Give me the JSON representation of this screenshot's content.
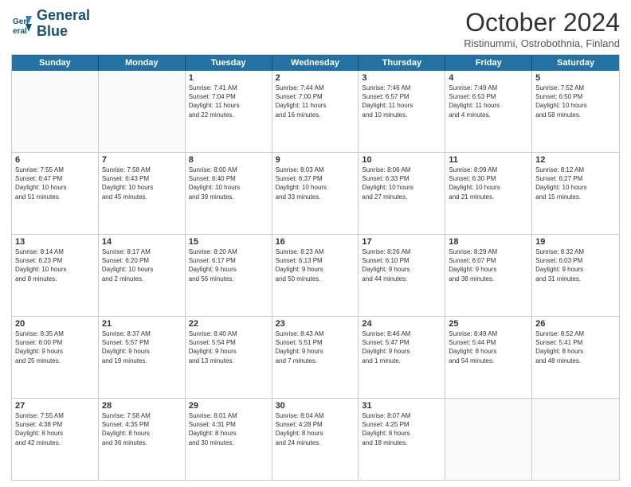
{
  "header": {
    "logo_line1": "General",
    "logo_line2": "Blue",
    "month": "October 2024",
    "location": "Ristinummi, Ostrobothnia, Finland"
  },
  "weekdays": [
    "Sunday",
    "Monday",
    "Tuesday",
    "Wednesday",
    "Thursday",
    "Friday",
    "Saturday"
  ],
  "rows": [
    [
      {
        "day": "",
        "info": ""
      },
      {
        "day": "",
        "info": ""
      },
      {
        "day": "1",
        "info": "Sunrise: 7:41 AM\nSunset: 7:04 PM\nDaylight: 11 hours\nand 22 minutes."
      },
      {
        "day": "2",
        "info": "Sunrise: 7:44 AM\nSunset: 7:00 PM\nDaylight: 11 hours\nand 16 minutes."
      },
      {
        "day": "3",
        "info": "Sunrise: 7:46 AM\nSunset: 6:57 PM\nDaylight: 11 hours\nand 10 minutes."
      },
      {
        "day": "4",
        "info": "Sunrise: 7:49 AM\nSunset: 6:53 PM\nDaylight: 11 hours\nand 4 minutes."
      },
      {
        "day": "5",
        "info": "Sunrise: 7:52 AM\nSunset: 6:50 PM\nDaylight: 10 hours\nand 58 minutes."
      }
    ],
    [
      {
        "day": "6",
        "info": "Sunrise: 7:55 AM\nSunset: 6:47 PM\nDaylight: 10 hours\nand 51 minutes."
      },
      {
        "day": "7",
        "info": "Sunrise: 7:58 AM\nSunset: 6:43 PM\nDaylight: 10 hours\nand 45 minutes."
      },
      {
        "day": "8",
        "info": "Sunrise: 8:00 AM\nSunset: 6:40 PM\nDaylight: 10 hours\nand 39 minutes."
      },
      {
        "day": "9",
        "info": "Sunrise: 8:03 AM\nSunset: 6:37 PM\nDaylight: 10 hours\nand 33 minutes."
      },
      {
        "day": "10",
        "info": "Sunrise: 8:06 AM\nSunset: 6:33 PM\nDaylight: 10 hours\nand 27 minutes."
      },
      {
        "day": "11",
        "info": "Sunrise: 8:09 AM\nSunset: 6:30 PM\nDaylight: 10 hours\nand 21 minutes."
      },
      {
        "day": "12",
        "info": "Sunrise: 8:12 AM\nSunset: 6:27 PM\nDaylight: 10 hours\nand 15 minutes."
      }
    ],
    [
      {
        "day": "13",
        "info": "Sunrise: 8:14 AM\nSunset: 6:23 PM\nDaylight: 10 hours\nand 8 minutes."
      },
      {
        "day": "14",
        "info": "Sunrise: 8:17 AM\nSunset: 6:20 PM\nDaylight: 10 hours\nand 2 minutes."
      },
      {
        "day": "15",
        "info": "Sunrise: 8:20 AM\nSunset: 6:17 PM\nDaylight: 9 hours\nand 56 minutes."
      },
      {
        "day": "16",
        "info": "Sunrise: 8:23 AM\nSunset: 6:13 PM\nDaylight: 9 hours\nand 50 minutes."
      },
      {
        "day": "17",
        "info": "Sunrise: 8:26 AM\nSunset: 6:10 PM\nDaylight: 9 hours\nand 44 minutes."
      },
      {
        "day": "18",
        "info": "Sunrise: 8:29 AM\nSunset: 6:07 PM\nDaylight: 9 hours\nand 38 minutes."
      },
      {
        "day": "19",
        "info": "Sunrise: 8:32 AM\nSunset: 6:03 PM\nDaylight: 9 hours\nand 31 minutes."
      }
    ],
    [
      {
        "day": "20",
        "info": "Sunrise: 8:35 AM\nSunset: 6:00 PM\nDaylight: 9 hours\nand 25 minutes."
      },
      {
        "day": "21",
        "info": "Sunrise: 8:37 AM\nSunset: 5:57 PM\nDaylight: 9 hours\nand 19 minutes."
      },
      {
        "day": "22",
        "info": "Sunrise: 8:40 AM\nSunset: 5:54 PM\nDaylight: 9 hours\nand 13 minutes."
      },
      {
        "day": "23",
        "info": "Sunrise: 8:43 AM\nSunset: 5:51 PM\nDaylight: 9 hours\nand 7 minutes."
      },
      {
        "day": "24",
        "info": "Sunrise: 8:46 AM\nSunset: 5:47 PM\nDaylight: 9 hours\nand 1 minute."
      },
      {
        "day": "25",
        "info": "Sunrise: 8:49 AM\nSunset: 5:44 PM\nDaylight: 8 hours\nand 54 minutes."
      },
      {
        "day": "26",
        "info": "Sunrise: 8:52 AM\nSunset: 5:41 PM\nDaylight: 8 hours\nand 48 minutes."
      }
    ],
    [
      {
        "day": "27",
        "info": "Sunrise: 7:55 AM\nSunset: 4:38 PM\nDaylight: 8 hours\nand 42 minutes."
      },
      {
        "day": "28",
        "info": "Sunrise: 7:58 AM\nSunset: 4:35 PM\nDaylight: 8 hours\nand 36 minutes."
      },
      {
        "day": "29",
        "info": "Sunrise: 8:01 AM\nSunset: 4:31 PM\nDaylight: 8 hours\nand 30 minutes."
      },
      {
        "day": "30",
        "info": "Sunrise: 8:04 AM\nSunset: 4:28 PM\nDaylight: 8 hours\nand 24 minutes."
      },
      {
        "day": "31",
        "info": "Sunrise: 8:07 AM\nSunset: 4:25 PM\nDaylight: 8 hours\nand 18 minutes."
      },
      {
        "day": "",
        "info": ""
      },
      {
        "day": "",
        "info": ""
      }
    ]
  ]
}
